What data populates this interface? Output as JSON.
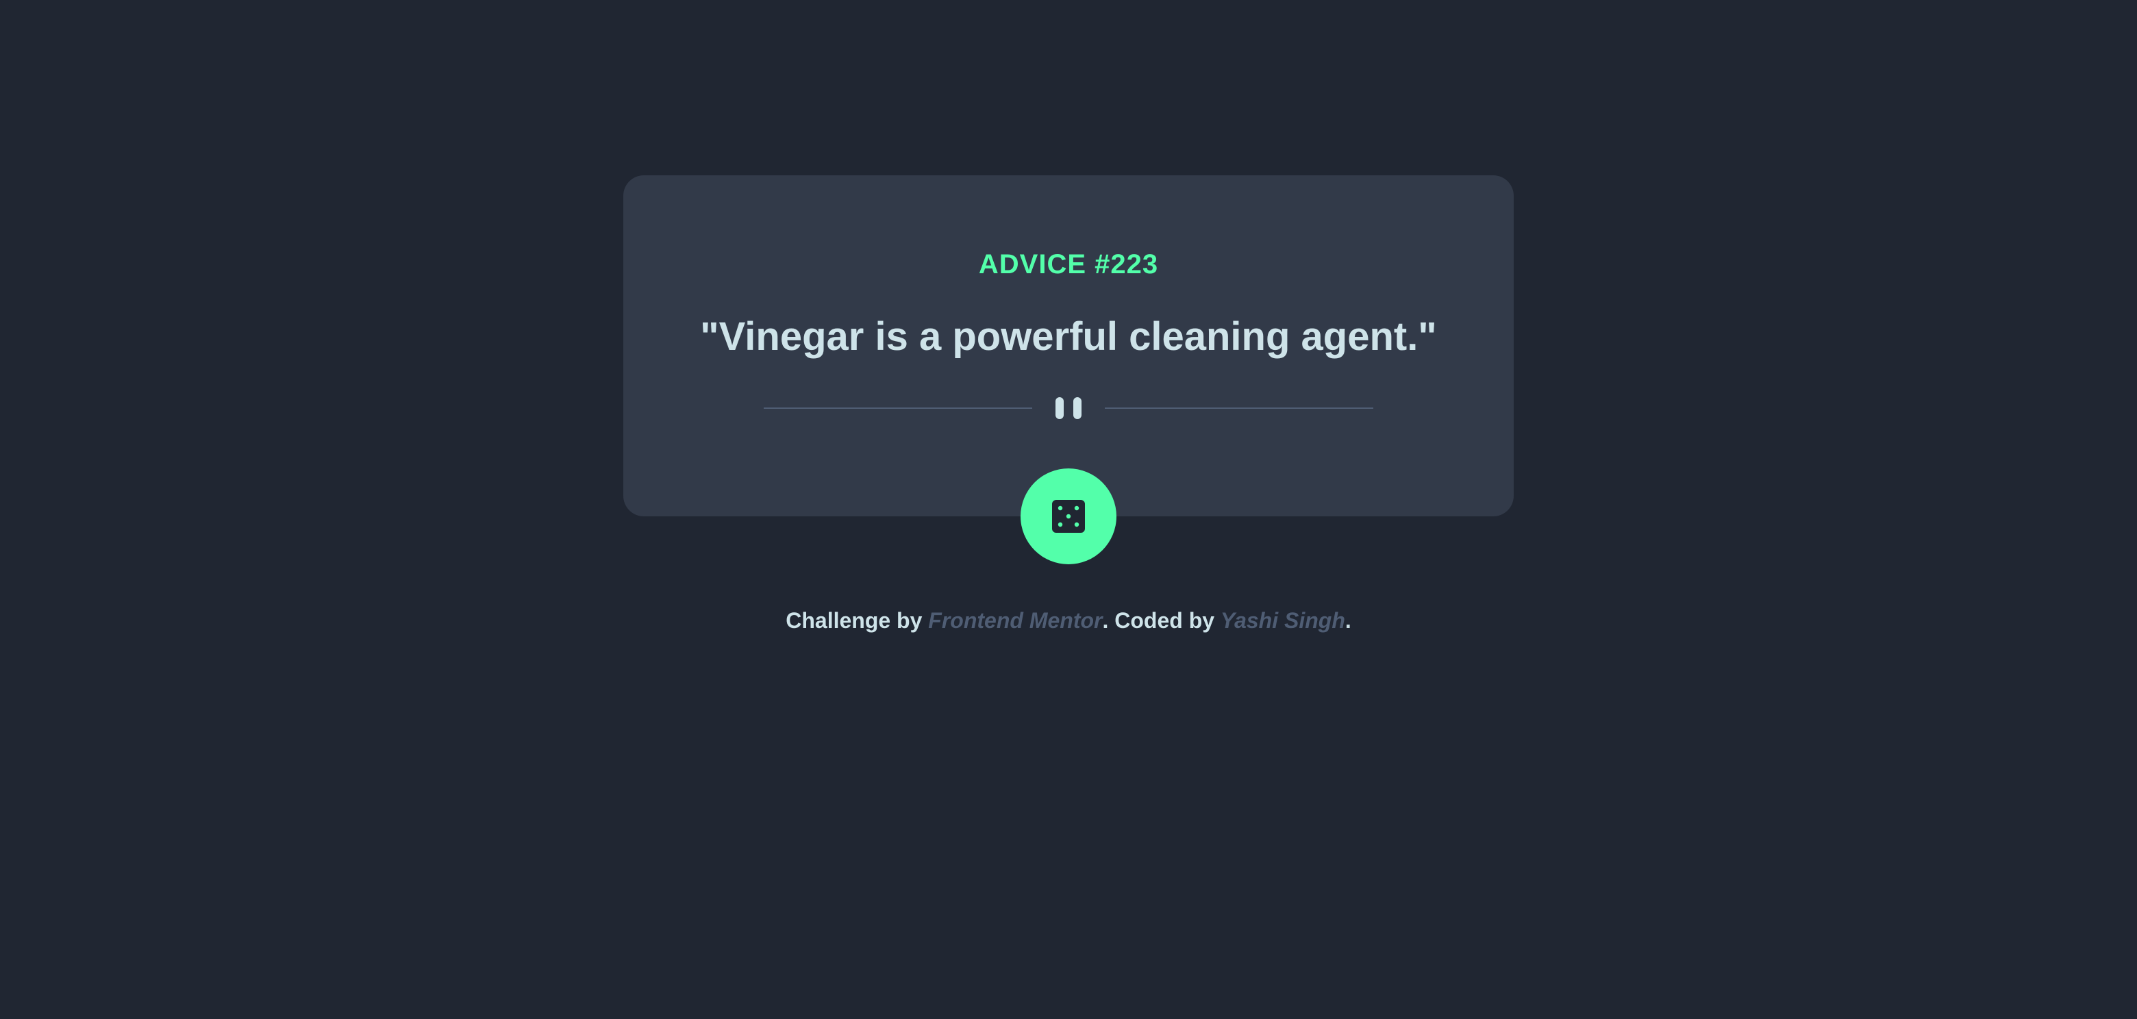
{
  "card": {
    "advice_label": "ADVICE #223",
    "quote": "\"Vinegar is a powerful cleaning agent.\""
  },
  "divider": {
    "icon": "pause-icon"
  },
  "dice_button": {
    "icon": "dice-icon"
  },
  "footer": {
    "challenge_prefix": "Challenge by ",
    "challenge_link": "Frontend Mentor",
    "coded_prefix": ". Coded by ",
    "coded_link": "Yashi Singh",
    "suffix": "."
  },
  "colors": {
    "background": "#202632",
    "card": "#323a49",
    "accent": "#53ffaa",
    "text": "#cee3e9",
    "muted": "#4f5d74"
  }
}
